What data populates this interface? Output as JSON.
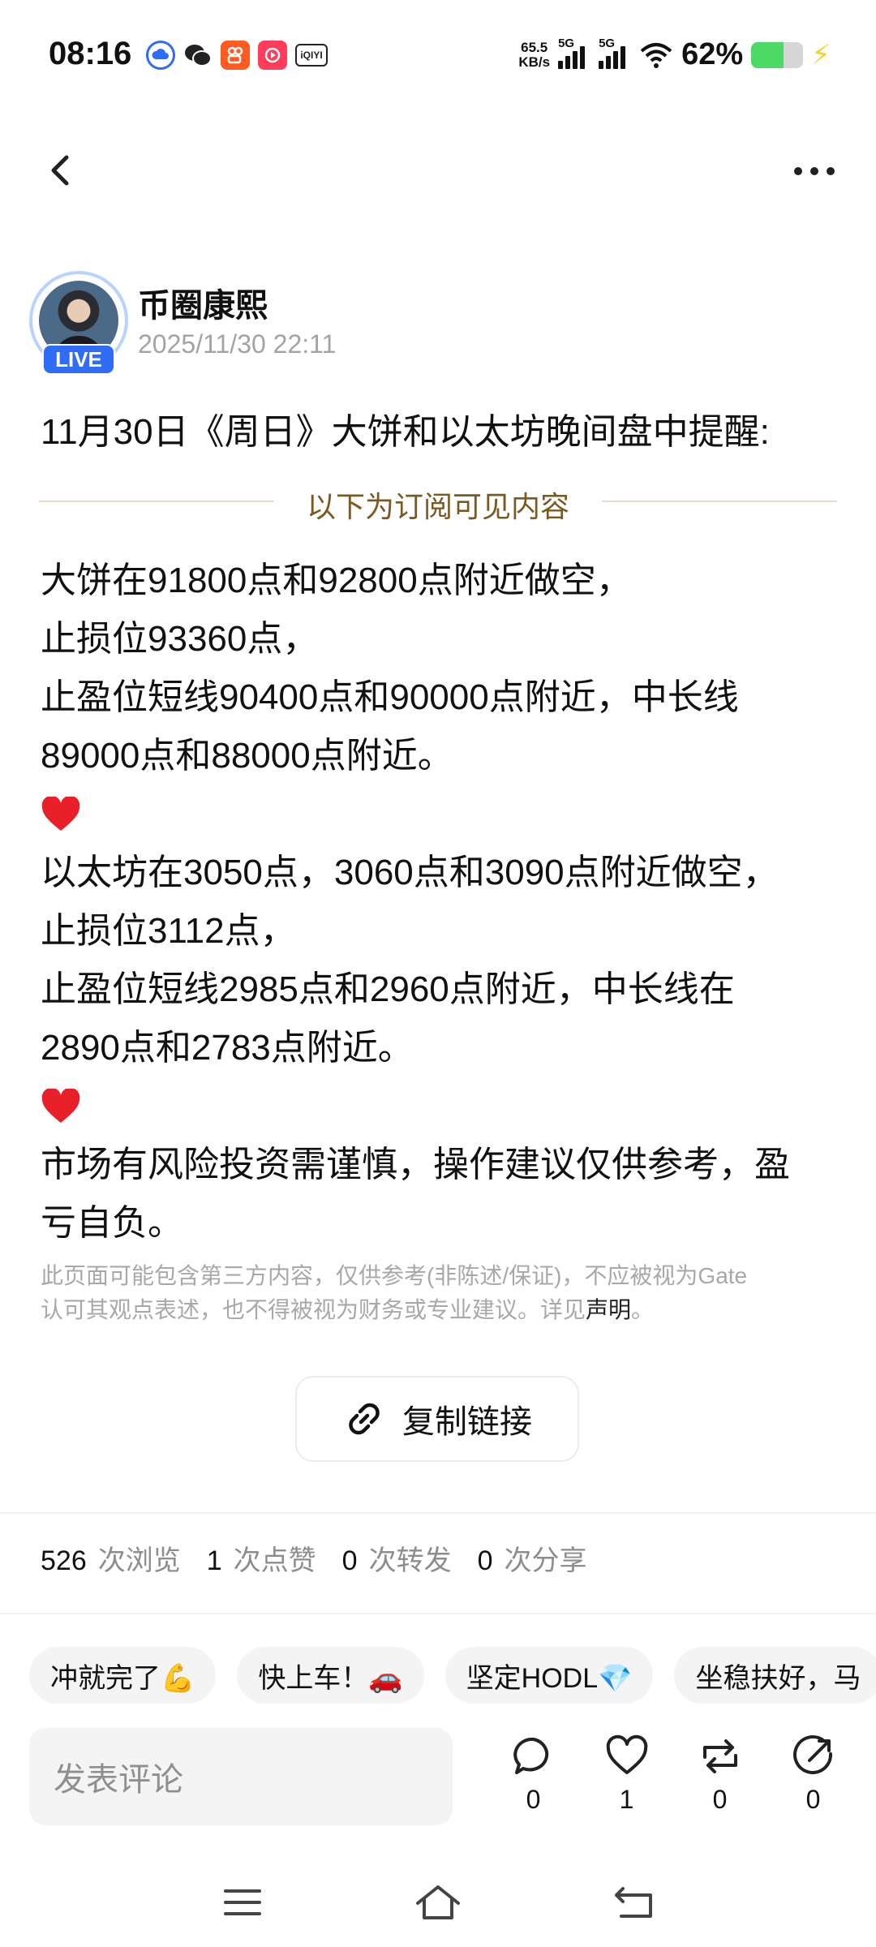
{
  "status_bar": {
    "time": "08:16",
    "net_speed_value": "65.5",
    "net_speed_unit": "KB/s",
    "signal1_label": "5G",
    "signal2_label": "5G",
    "battery_percent": "62%",
    "battery_level": 0.62,
    "app_icons": [
      "cloud-app-icon",
      "wechat-icon",
      "kuaishou-icon",
      "video-app-icon",
      "iqiyi-icon"
    ],
    "iqiyi_text": "iQIYI"
  },
  "author": {
    "name": "币圈康熙",
    "time": "2025/11/30 22:11",
    "live_label": "LIVE"
  },
  "post": {
    "title": "11月30日《周日》大饼和以太坊晚间盘中提醒:",
    "subscriber_divider": "以下为订阅可见内容",
    "lines": [
      "大饼在91800点和92800点附近做空，",
      "止损位93360点，",
      "止盈位短线90400点和90000点附近，中长线",
      "89000点和88000点附近。",
      "以太坊在3050点，3060点和3090点附近做空，",
      "止损位3112点，",
      "止盈位短线2985点和2960点附近，中长线在",
      "2890点和2783点附近。",
      "市场有风险投资需谨慎，操作建议仅供参考，盈",
      "亏自负。"
    ],
    "disclaimer_line1": "此页面可能包含第三方内容，仅供参考(非陈述/保证)，不应被视为Gate",
    "disclaimer_line2": "认可其观点表述，也不得被视为财务或专业建议。详见",
    "disclaimer_link": "声明",
    "disclaimer_end": "。",
    "copy_link_label": "复制链接"
  },
  "stats": {
    "views": "526",
    "views_label": "次浏览",
    "likes": "1",
    "likes_label": "次点赞",
    "reposts": "0",
    "reposts_label": "次转发",
    "shares": "0",
    "shares_label": "次分享"
  },
  "quick_replies": [
    "冲就完了💪",
    "快上车！🚗",
    "坚定HODL💎",
    "坐稳扶好，马"
  ],
  "comment": {
    "placeholder": "发表评论",
    "comment_count": "0",
    "like_count": "1",
    "repost_count": "0",
    "share_count": "0"
  },
  "colors": {
    "live_badge": "#2f6df6",
    "divider_text": "#7a5a22",
    "heart": "#e8202a",
    "battery_fill": "#4cd964"
  }
}
